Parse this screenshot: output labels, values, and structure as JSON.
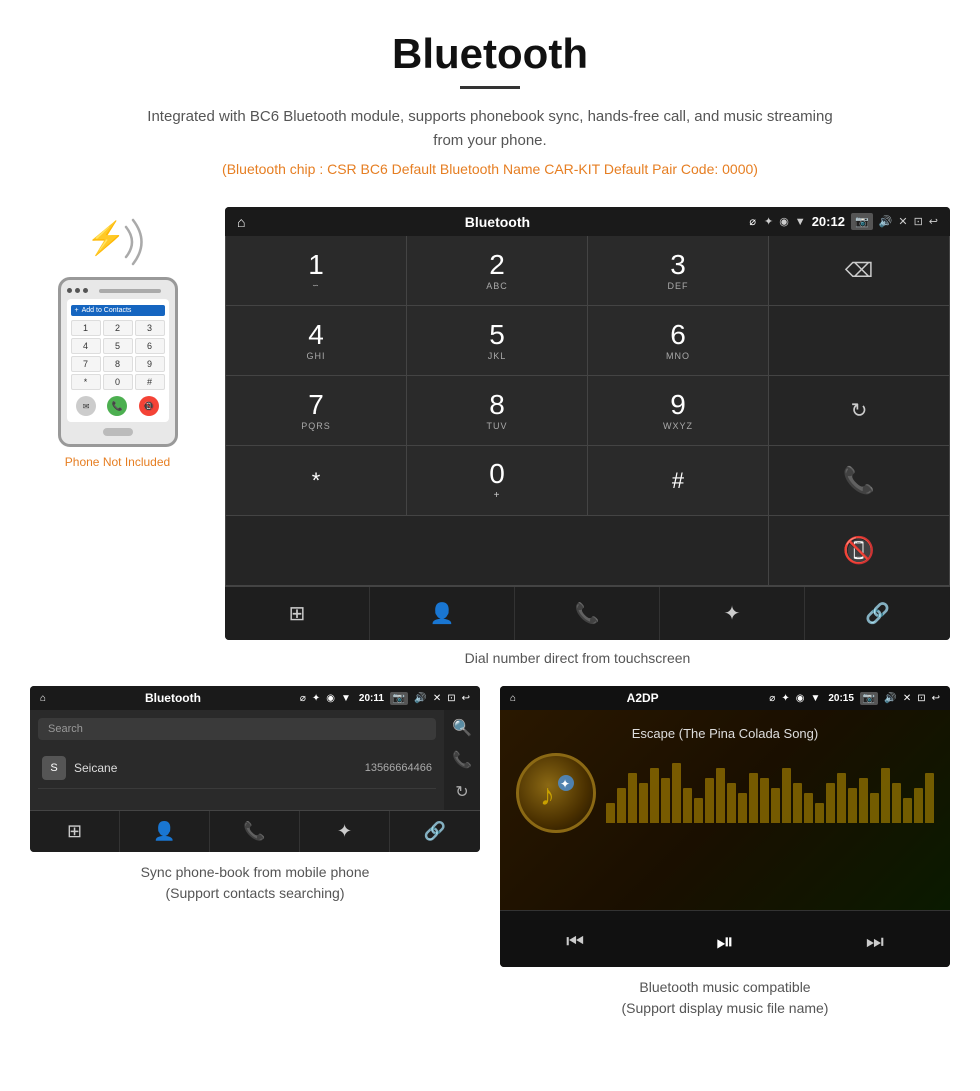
{
  "page": {
    "title": "Bluetooth",
    "description": "Integrated with BC6 Bluetooth module, supports phonebook sync, hands-free call, and music streaming from your phone.",
    "specs": "(Bluetooth chip : CSR BC6    Default Bluetooth Name CAR-KIT    Default Pair Code: 0000)",
    "phone_not_included": "Phone Not Included",
    "dial_caption": "Dial number direct from touchscreen",
    "phonebook_caption": "Sync phone-book from mobile phone\n(Support contacts searching)",
    "music_caption": "Bluetooth music compatible\n(Support display music file name)"
  },
  "dial_screen": {
    "status_bar": {
      "title": "Bluetooth",
      "time": "20:12",
      "usb_icon": "⌀",
      "bt_icon": "✦",
      "location_icon": "◉",
      "signal_icon": "▼"
    },
    "keys": [
      {
        "main": "1",
        "sub": ""
      },
      {
        "main": "2",
        "sub": "ABC"
      },
      {
        "main": "3",
        "sub": "DEF"
      },
      {
        "main": "⌫",
        "sub": ""
      },
      {
        "main": "4",
        "sub": "GHI"
      },
      {
        "main": "5",
        "sub": "JKL"
      },
      {
        "main": "6",
        "sub": "MNO"
      },
      {
        "main": "",
        "sub": ""
      },
      {
        "main": "7",
        "sub": "PQRS"
      },
      {
        "main": "8",
        "sub": "TUV"
      },
      {
        "main": "9",
        "sub": "WXYZ"
      },
      {
        "main": "↻",
        "sub": ""
      },
      {
        "main": "*",
        "sub": ""
      },
      {
        "main": "0",
        "sub": "+"
      },
      {
        "main": "#",
        "sub": ""
      },
      {
        "main": "📞",
        "sub": "green"
      },
      {
        "main": "📵",
        "sub": "red"
      }
    ],
    "action_bar": {
      "icons": [
        "⊞",
        "👤",
        "📞",
        "✦",
        "🔗"
      ]
    }
  },
  "phonebook_screen": {
    "status_bar": {
      "title": "Bluetooth",
      "time": "20:11"
    },
    "search_placeholder": "Search",
    "contact": {
      "letter": "S",
      "name": "Seicane",
      "number": "13566664466"
    },
    "bottom_icons": [
      "⊞",
      "👤",
      "📞",
      "✦",
      "🔗"
    ]
  },
  "music_screen": {
    "status_bar": {
      "title": "A2DP",
      "time": "20:15"
    },
    "song_title": "Escape (The Pina Colada Song)",
    "controls": {
      "prev": "⏮",
      "play": "⏯",
      "next": "⏭"
    },
    "visualizer_bars": [
      20,
      35,
      50,
      40,
      55,
      45,
      60,
      35,
      25,
      45,
      55,
      40,
      30,
      50,
      45,
      35,
      55,
      40,
      30,
      20,
      40,
      50,
      35,
      45,
      30,
      55,
      40,
      25,
      35,
      50
    ]
  },
  "phone_keys": [
    [
      "1",
      "2",
      "3"
    ],
    [
      "4",
      "5",
      "6"
    ],
    [
      "7",
      "8",
      "9"
    ],
    [
      "*",
      "0",
      "#"
    ]
  ]
}
